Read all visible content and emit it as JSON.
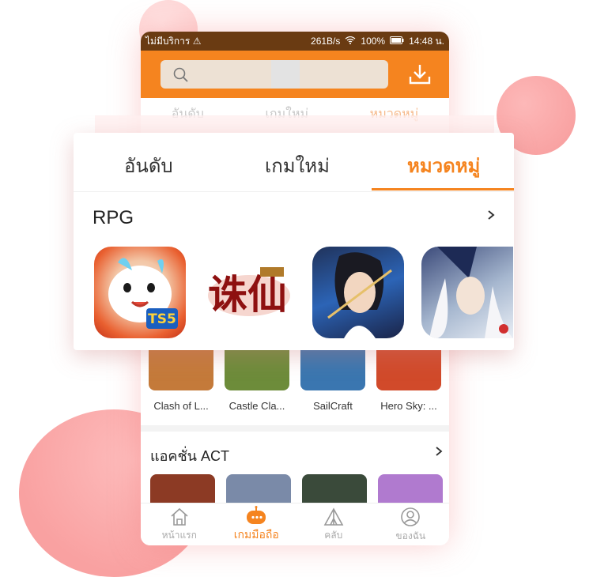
{
  "statusbar": {
    "carrier": "ไม่มีบริการ ⚠",
    "speed": "261B/s",
    "battery": "100%",
    "time": "14:48 น."
  },
  "phone_tabs": [
    "อันดับ",
    "เกมใหม่",
    "หมวดหมู่"
  ],
  "overlay": {
    "tabs": [
      {
        "label": "อันดับ",
        "active": false
      },
      {
        "label": "เกมใหม่",
        "active": false
      },
      {
        "label": "หมวดหมู่",
        "active": true
      }
    ],
    "category": "RPG",
    "games": [
      {
        "name": "",
        "icon": "ts5-legend-icon"
      },
      {
        "name": "",
        "icon": "zhu-xian-icon"
      },
      {
        "name": "",
        "icon": "swordsman-icon"
      },
      {
        "name": "",
        "icon": "onmyoji-icon"
      }
    ],
    "logo_text_zhuxian": "诛仙"
  },
  "rpg_apps": [
    {
      "name": "Clash of L...",
      "color": "#c47a3a"
    },
    {
      "name": "Castle Cla...",
      "color": "#6d8c3a"
    },
    {
      "name": "SailCraft",
      "color": "#3a76b0"
    },
    {
      "name": "Hero Sky: ...",
      "color": "#d14a2a"
    }
  ],
  "act_section": {
    "title": "แอคชั่น ACT",
    "apps": [
      {
        "color": "#8c3a24"
      },
      {
        "color": "#7a8aa8"
      },
      {
        "color": "#3a4a3a"
      },
      {
        "color": "#b07acf"
      }
    ]
  },
  "tabbar": [
    {
      "label": "หน้าแรก",
      "icon": "home-icon",
      "active": false
    },
    {
      "label": "เกมมือถือ",
      "icon": "controller-icon",
      "active": true
    },
    {
      "label": "คลับ",
      "icon": "tent-icon",
      "active": false
    },
    {
      "label": "ของฉัน",
      "icon": "profile-icon",
      "active": false
    }
  ],
  "colors": {
    "accent": "#f5841f",
    "status_bar": "#6a3b12",
    "circle_pink": "#f79b9b"
  }
}
